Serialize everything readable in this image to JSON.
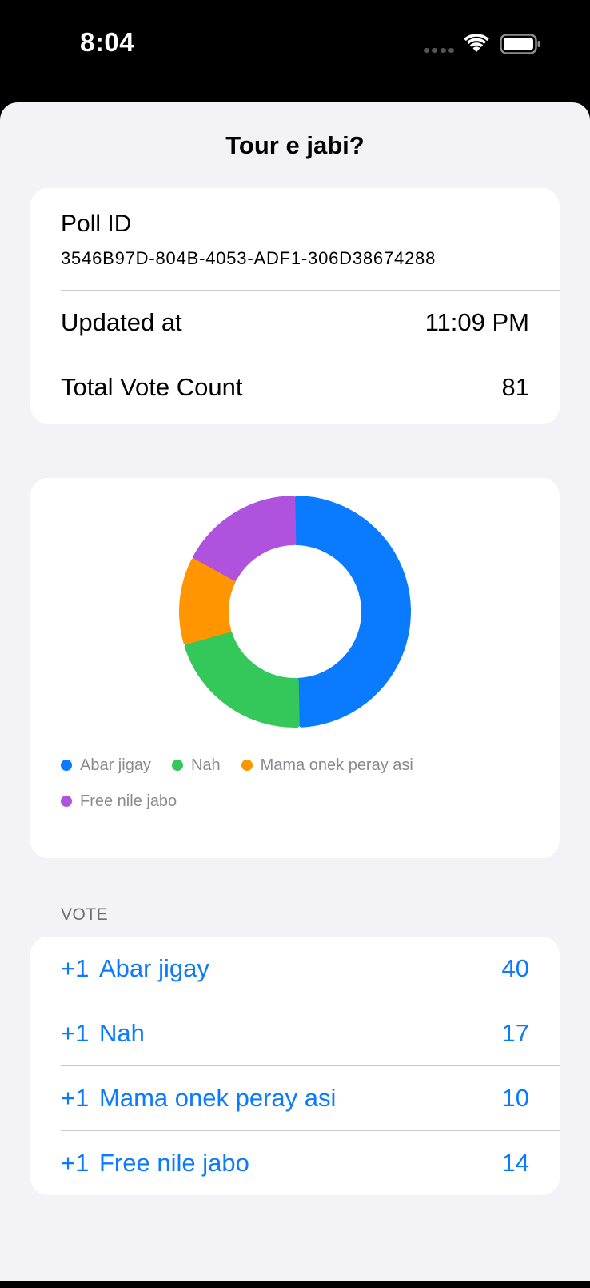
{
  "status_bar": {
    "time": "8:04",
    "icons": [
      "signal-dots-icon",
      "wifi-icon",
      "battery-icon"
    ]
  },
  "sheet": {
    "title": "Tour e jabi?"
  },
  "info": {
    "poll_id_label": "Poll ID",
    "poll_id_value": "3546B97D-804B-4053-ADF1-306D38674288",
    "updated_label": "Updated at",
    "updated_value": "11:09 PM",
    "total_label": "Total Vote Count",
    "total_value": "81"
  },
  "chart_data": {
    "type": "pie",
    "style": "donut",
    "categories": [
      "Abar jigay",
      "Nah",
      "Mama onek peray asi",
      "Free nile jabo"
    ],
    "values": [
      40,
      17,
      10,
      14
    ],
    "colors": [
      "#0a7aff",
      "#34c759",
      "#ff9500",
      "#af52de"
    ],
    "legend_position": "bottom-left"
  },
  "vote_section": {
    "header": "VOTE",
    "plus_label": "+1",
    "accent_color": "#0a7aff",
    "options": [
      {
        "label": "Abar jigay",
        "count": "40"
      },
      {
        "label": "Nah",
        "count": "17"
      },
      {
        "label": "Mama onek peray asi",
        "count": "10"
      },
      {
        "label": "Free nile jabo",
        "count": "14"
      }
    ]
  }
}
